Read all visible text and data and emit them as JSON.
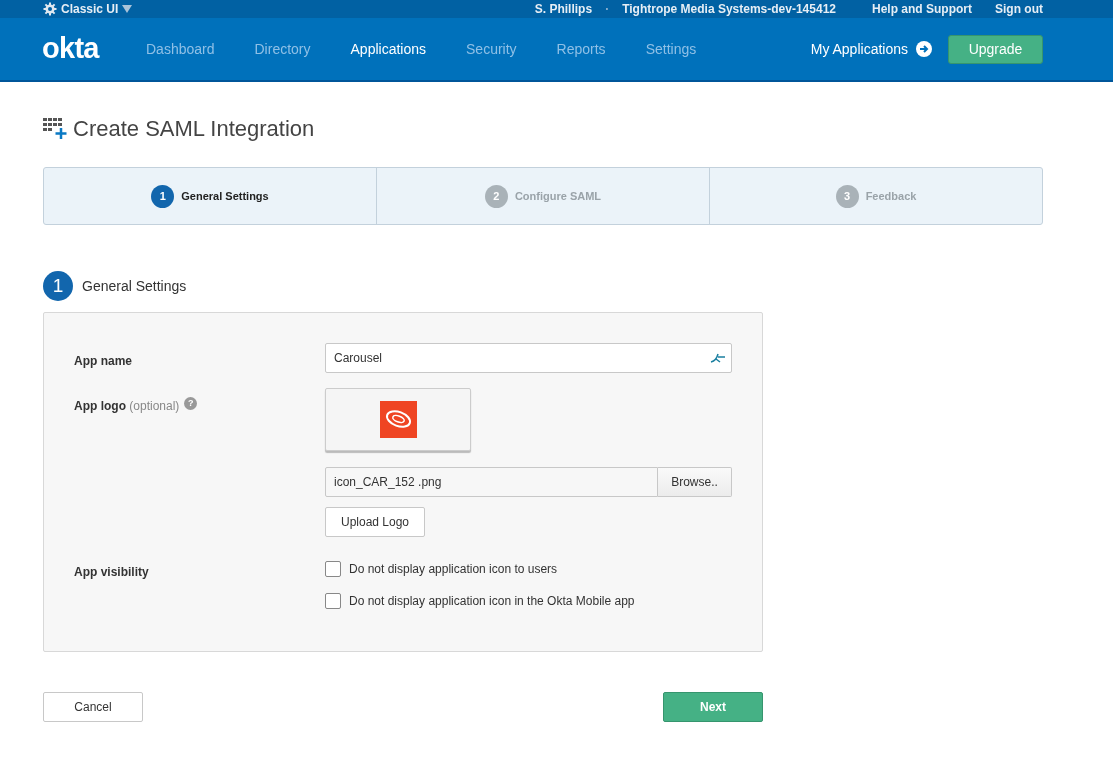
{
  "top_bar": {
    "menu": "Classic UI",
    "user": "S. Phillips",
    "separator": "·",
    "org": "Tightrope Media Systems-dev-145412",
    "links": [
      "Help and Support",
      "Sign out"
    ]
  },
  "nav": {
    "logo": "okta",
    "items": [
      {
        "label": "Dashboard",
        "selected": false
      },
      {
        "label": "Directory",
        "selected": false
      },
      {
        "label": "Applications",
        "selected": true
      },
      {
        "label": "Security",
        "selected": false
      },
      {
        "label": "Reports",
        "selected": false
      },
      {
        "label": "Settings",
        "selected": false
      }
    ],
    "my_applications": "My Applications",
    "upgrade": "Upgrade"
  },
  "page_title": "Create SAML Integration",
  "steps": [
    {
      "number": "1",
      "label": "General Settings",
      "selected": true
    },
    {
      "number": "2",
      "label": "Configure SAML",
      "selected": false
    },
    {
      "number": "3",
      "label": "Feedback",
      "selected": false
    }
  ],
  "section": {
    "number": "1",
    "title": "General Settings"
  },
  "form": {
    "app_name": {
      "label": "App name",
      "value": "Carousel"
    },
    "app_logo": {
      "label": "App logo",
      "hint": "(optional)",
      "help": "?",
      "file": "icon_CAR_152 .png",
      "browse": "Browse..",
      "upload": "Upload Logo"
    },
    "app_visibility": {
      "label": "App visibility",
      "options": [
        {
          "label": "Do not display application icon to users",
          "checked": false
        },
        {
          "label": "Do not display application icon in the Okta Mobile app",
          "checked": false
        }
      ]
    }
  },
  "buttons": {
    "cancel": "Cancel",
    "next": "Next"
  }
}
